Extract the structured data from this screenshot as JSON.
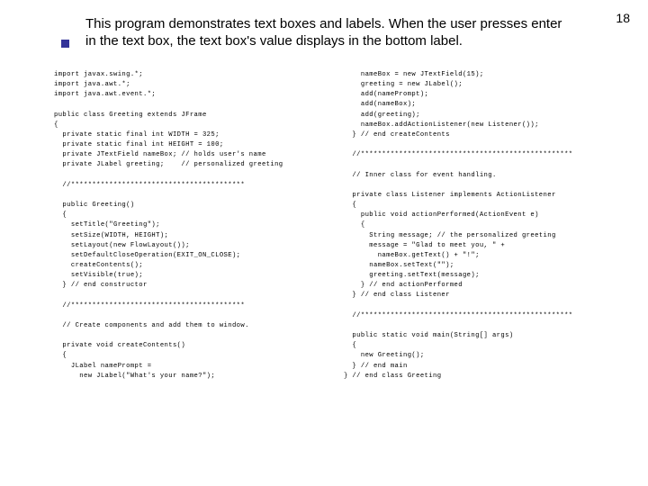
{
  "page_number": "18",
  "title_text": "This program demonstrates text boxes and labels. When the user presses enter in the text box, the text box's value displays in the bottom label.",
  "code_left": "import javax.swing.*;\nimport java.awt.*;\nimport java.awt.event.*;\n\npublic class Greeting extends JFrame\n{\n  private static final int WIDTH = 325;\n  private static final int HEIGHT = 100;\n  private JTextField nameBox; // holds user's name\n  private JLabel greeting;    // personalized greeting\n\n  //*****************************************\n\n  public Greeting()\n  {\n    setTitle(\"Greeting\");\n    setSize(WIDTH, HEIGHT);\n    setLayout(new FlowLayout());\n    setDefaultCloseOperation(EXIT_ON_CLOSE);\n    createContents();\n    setVisible(true);\n  } // end constructor\n\n  //*****************************************\n\n  // Create components and add them to window.\n\n  private void createContents()\n  {\n    JLabel namePrompt =\n      new JLabel(\"What's your name?\");",
  "code_right": "    nameBox = new JTextField(15);\n    greeting = new JLabel();\n    add(namePrompt);\n    add(nameBox);\n    add(greeting);\n    nameBox.addActionListener(new Listener());\n  } // end createContents\n\n  //**************************************************\n\n  // Inner class for event handling.\n\n  private class Listener implements ActionListener\n  {\n    public void actionPerformed(ActionEvent e)\n    {\n      String message; // the personalized greeting\n      message = \"Glad to meet you, \" +\n        nameBox.getText() + \"!\";\n      nameBox.setText(\"\");\n      greeting.setText(message);\n    } // end actionPerformed\n  } // end class Listener\n\n  //**************************************************\n\n  public static void main(String[] args)\n  {\n    new Greeting();\n  } // end main\n} // end class Greeting"
}
